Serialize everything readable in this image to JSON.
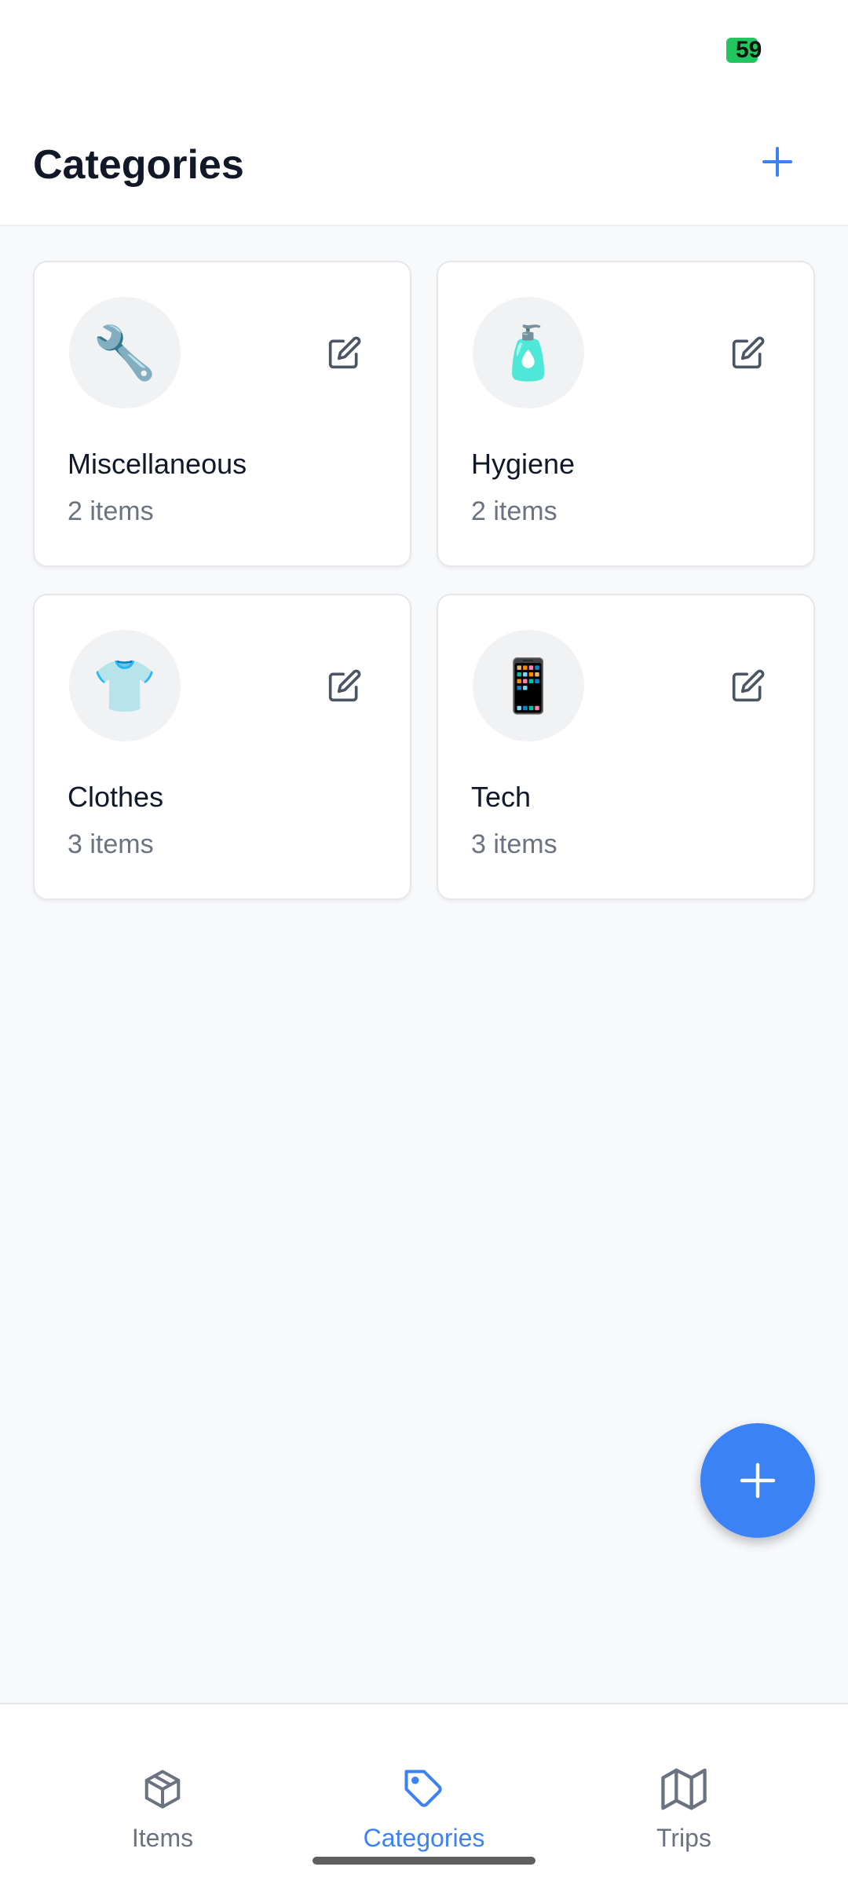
{
  "status": {
    "battery": "59"
  },
  "header": {
    "title": "Categories"
  },
  "categories": [
    {
      "name": "Miscellaneous",
      "count": "2 items",
      "emoji": "🔧"
    },
    {
      "name": "Hygiene",
      "count": "2 items",
      "emoji": "🧴"
    },
    {
      "name": "Clothes",
      "count": "3 items",
      "emoji": "👕"
    },
    {
      "name": "Tech",
      "count": "3 items",
      "emoji": "📱"
    }
  ],
  "tabs": [
    {
      "label": "Items",
      "icon": "box-icon"
    },
    {
      "label": "Categories",
      "icon": "tag-icon",
      "active": true
    },
    {
      "label": "Trips",
      "icon": "map-icon"
    }
  ],
  "colors": {
    "accent": "#3b82f6",
    "battery": "#22c55e"
  }
}
